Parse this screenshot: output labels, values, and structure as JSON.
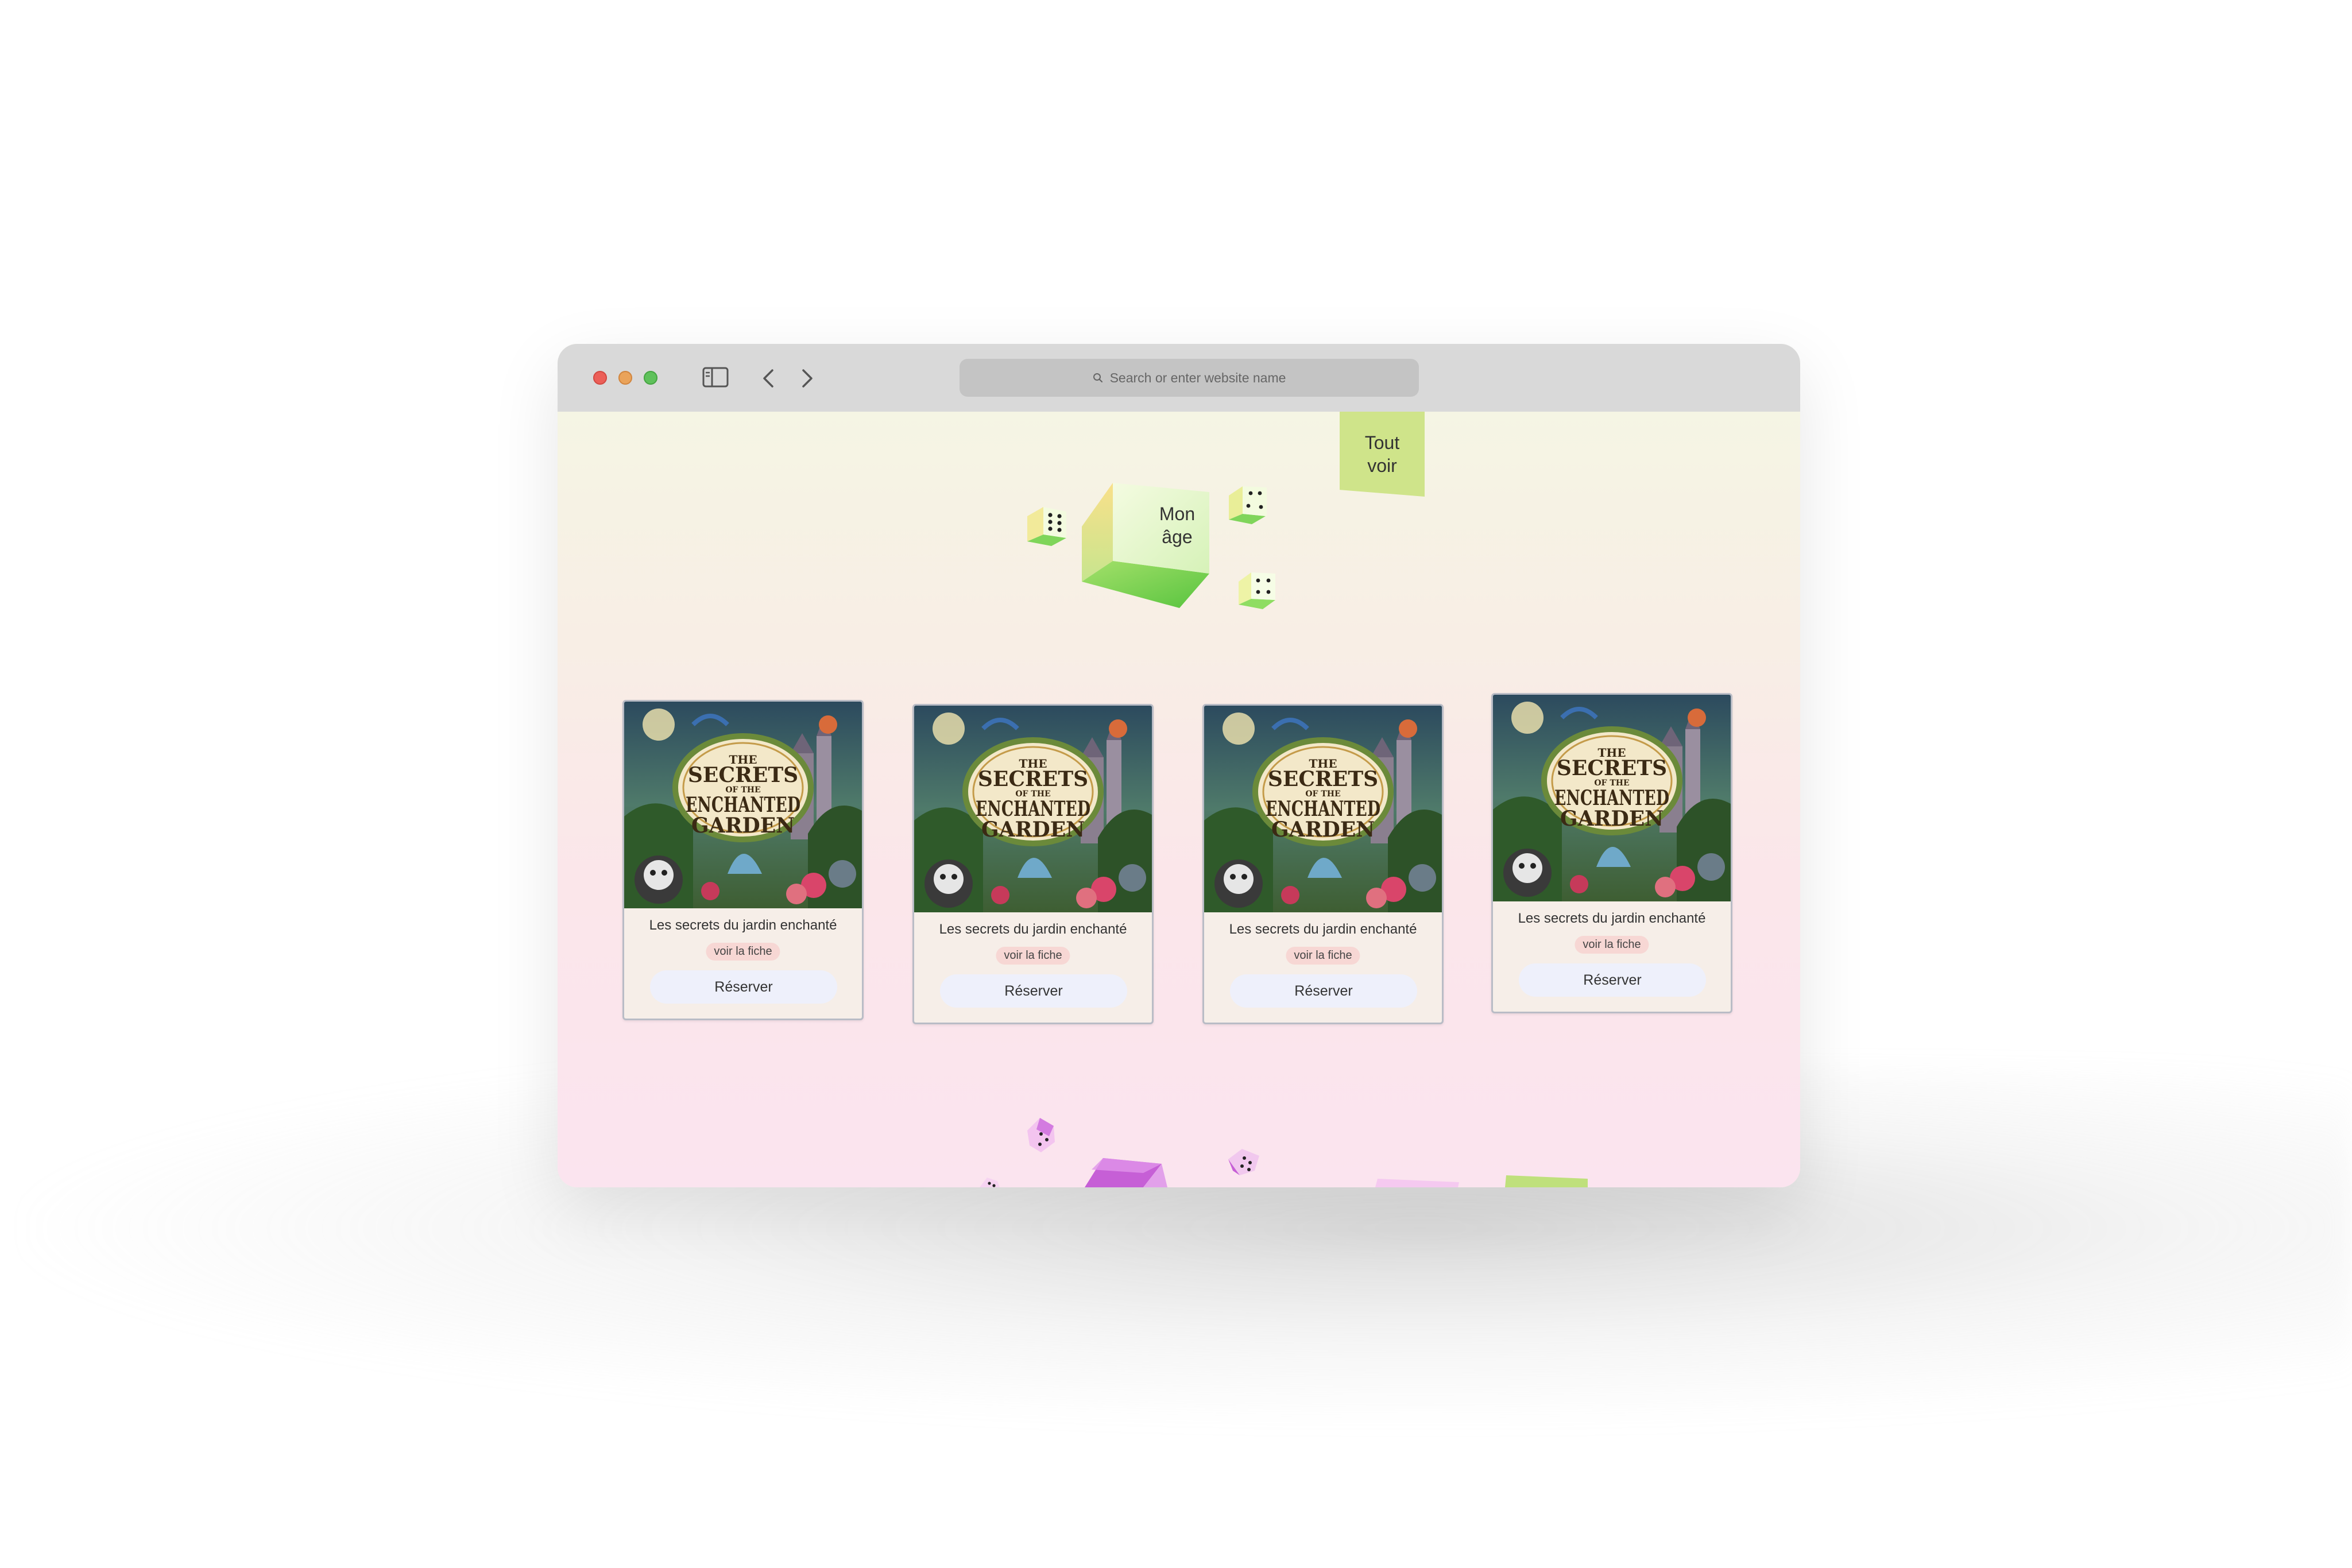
{
  "browser": {
    "search_placeholder": "Search or enter website name"
  },
  "page": {
    "tout_voir": "Tout voir",
    "mon_age": "Mon âge",
    "cards": [
      {
        "cover_alt": "The Secrets of the Enchanted Garden",
        "title": "Les secrets du jardin enchanté",
        "fiche_label": "voir la fiche",
        "reserve_label": "Réserver"
      },
      {
        "cover_alt": "The Secrets of the Enchanted Garden",
        "title": "Les secrets du jardin enchanté",
        "fiche_label": "voir la fiche",
        "reserve_label": "Réserver"
      },
      {
        "cover_alt": "The Secrets of the Enchanted Garden",
        "title": "Les secrets du jardin enchanté",
        "fiche_label": "voir la fiche",
        "reserve_label": "Réserver"
      },
      {
        "cover_alt": "The Secrets of the Enchanted Garden",
        "title": "Les secrets du jardin enchanté",
        "fiche_label": "voir la fiche",
        "reserve_label": "Réserver"
      }
    ],
    "cover_text": {
      "line1": "THE",
      "line2": "SECRETS",
      "line3": "OF THE",
      "line4": "ENCHANTED",
      "line5": "GARDEN"
    }
  },
  "colors": {
    "accent_green": "#cfe48a",
    "cube_green": "#7ed957",
    "cube_pink": "#c65fd6",
    "fiche_bg": "#f7d7d4",
    "reserve_bg": "#eef0fb"
  }
}
